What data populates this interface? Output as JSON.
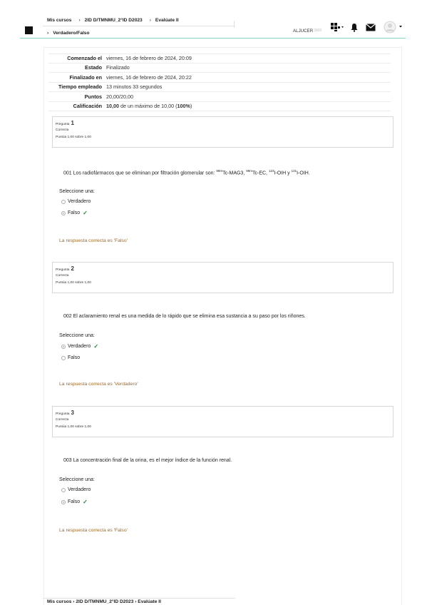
{
  "breadcrumb": {
    "item1": "Mis cursos",
    "item2": "2ID D/TMNMU_2°ID D2023",
    "item3": "Evalúate II",
    "current": "Verdadero/Falso",
    "sep": "›"
  },
  "user": {
    "name": "ALJUCER",
    "sub": "3000"
  },
  "icons": {
    "apps": "apps-grid-icon",
    "bell": "bell-icon",
    "mail": "mail-icon",
    "avatar": "avatar-icon"
  },
  "summary": [
    {
      "label": "Comenzado el",
      "value": "viernes, 16 de febrero de 2024, 20:09"
    },
    {
      "label": "Estado",
      "value": "Finalizado"
    },
    {
      "label": "Finalizado en",
      "value": "viernes, 16 de febrero de 2024, 20:22"
    },
    {
      "label": "Tiempo empleado",
      "value": "13 minutos 33 segundos"
    },
    {
      "label": "Puntos",
      "value": "20,00/20,00"
    },
    {
      "label": "Calificación",
      "value_bold1": "10,00",
      "value_mid": " de un máximo de 10,00 (",
      "value_bold2": "100%",
      "value_end": ")"
    }
  ],
  "questions": [
    {
      "label": "Pregunta",
      "number": "1",
      "state": "Correcta",
      "grade": "Puntúa 1,00 sobre 1,00",
      "text_a": "001 Los radiofármacos que se eliminan por filtración glomerular son: ",
      "sup1": "99m",
      "t1": "Tc-MAG3, ",
      "sup2": "99m",
      "t2": "Tc-EC, ",
      "sup3": "123",
      "t3": "I-OIH y ",
      "sup4": "131",
      "t4": "I-OIH.",
      "prompt": "Seleccione una:",
      "option1": "Verdadero",
      "option2": "Falso",
      "feedback": "La respuesta correcta es 'Falso'"
    },
    {
      "label": "Pregunta",
      "number": "2",
      "state": "Correcta",
      "grade": "Puntúa 1,00 sobre 1,00",
      "text": "002 El aclaramiento renal es una medida de lo rápido que se elimina esa sustancia a su paso por los riñones.",
      "prompt": "Seleccione una:",
      "option1": "Verdadero",
      "option2": "Falso",
      "feedback": "La respuesta correcta es 'Verdadero'"
    },
    {
      "label": "Pregunta",
      "number": "3",
      "state": "Correcta",
      "grade": "Puntúa 1,00 sobre 1,00",
      "text": "003 La concentración final de la orina, es el mejor índice de la función renal.",
      "prompt": "Seleccione una:",
      "option1": "Verdadero",
      "option2": "Falso",
      "feedback": "La respuesta correcta es 'Falso'"
    }
  ],
  "checkmark": "✓",
  "colors": {
    "accent_line": "#7fd3c6",
    "feedback": "#a0692a",
    "check": "#1f8a3c"
  }
}
